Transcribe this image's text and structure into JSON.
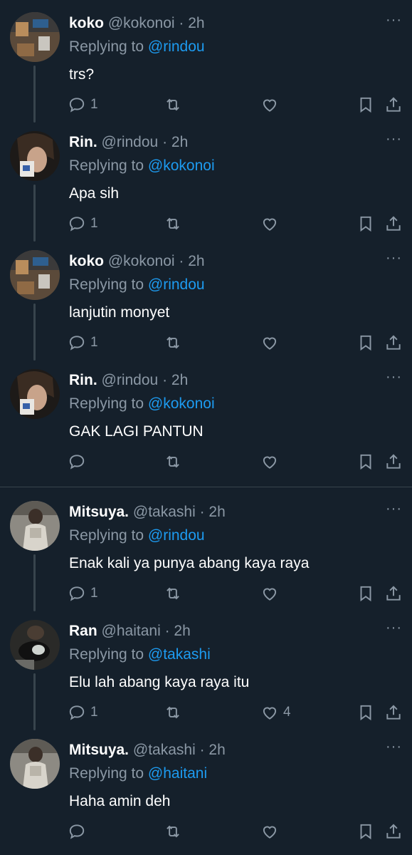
{
  "tweets": [
    {
      "name": "koko",
      "handle": "@kokonoi",
      "dot": "·",
      "time": "2h",
      "reply_prefix": "Replying to",
      "reply_to": "@rindou",
      "text": "trs?",
      "reply_count": "1",
      "like_count": "",
      "avatar": "room"
    },
    {
      "name": "Rin.",
      "handle": "@rindou",
      "dot": "·",
      "time": "2h",
      "reply_prefix": "Replying to",
      "reply_to": "@kokonoi",
      "text": "Apa sih",
      "reply_count": "1",
      "like_count": "",
      "avatar": "dark-hair"
    },
    {
      "name": "koko",
      "handle": "@kokonoi",
      "dot": "·",
      "time": "2h",
      "reply_prefix": "Replying to",
      "reply_to": "@rindou",
      "text": "lanjutin monyet",
      "reply_count": "1",
      "like_count": "",
      "avatar": "room"
    },
    {
      "name": "Rin.",
      "handle": "@rindou",
      "dot": "·",
      "time": "2h",
      "reply_prefix": "Replying to",
      "reply_to": "@kokonoi",
      "text": "GAK LAGI PANTUN",
      "reply_count": "",
      "like_count": "",
      "avatar": "dark-hair"
    },
    {
      "name": "Mitsuya.",
      "handle": "@takashi",
      "dot": "·",
      "time": "2h",
      "reply_prefix": "Replying to",
      "reply_to": "@rindou",
      "text": "Enak kali ya punya abang kaya raya",
      "reply_count": "1",
      "like_count": "",
      "avatar": "mirror"
    },
    {
      "name": "Ran",
      "handle": "@haitani",
      "dot": "·",
      "time": "2h",
      "reply_prefix": "Replying to",
      "reply_to": "@takashi",
      "text": "Elu lah abang kaya raya itu",
      "reply_count": "1",
      "like_count": "4",
      "avatar": "motorbike"
    },
    {
      "name": "Mitsuya.",
      "handle": "@takashi",
      "dot": "·",
      "time": "2h",
      "reply_prefix": "Replying to",
      "reply_to": "@haitani",
      "text": "Haha amin deh",
      "reply_count": "",
      "like_count": "",
      "avatar": "mirror"
    }
  ],
  "icons": {
    "reply": "reply-icon",
    "retweet": "retweet-icon",
    "like": "heart-icon",
    "bookmark": "bookmark-icon",
    "share": "share-icon",
    "more": "more-icon"
  },
  "colors": {
    "background": "#15202b",
    "muted": "#8b98a5",
    "link": "#1d9bf0",
    "divider": "#38444d"
  }
}
